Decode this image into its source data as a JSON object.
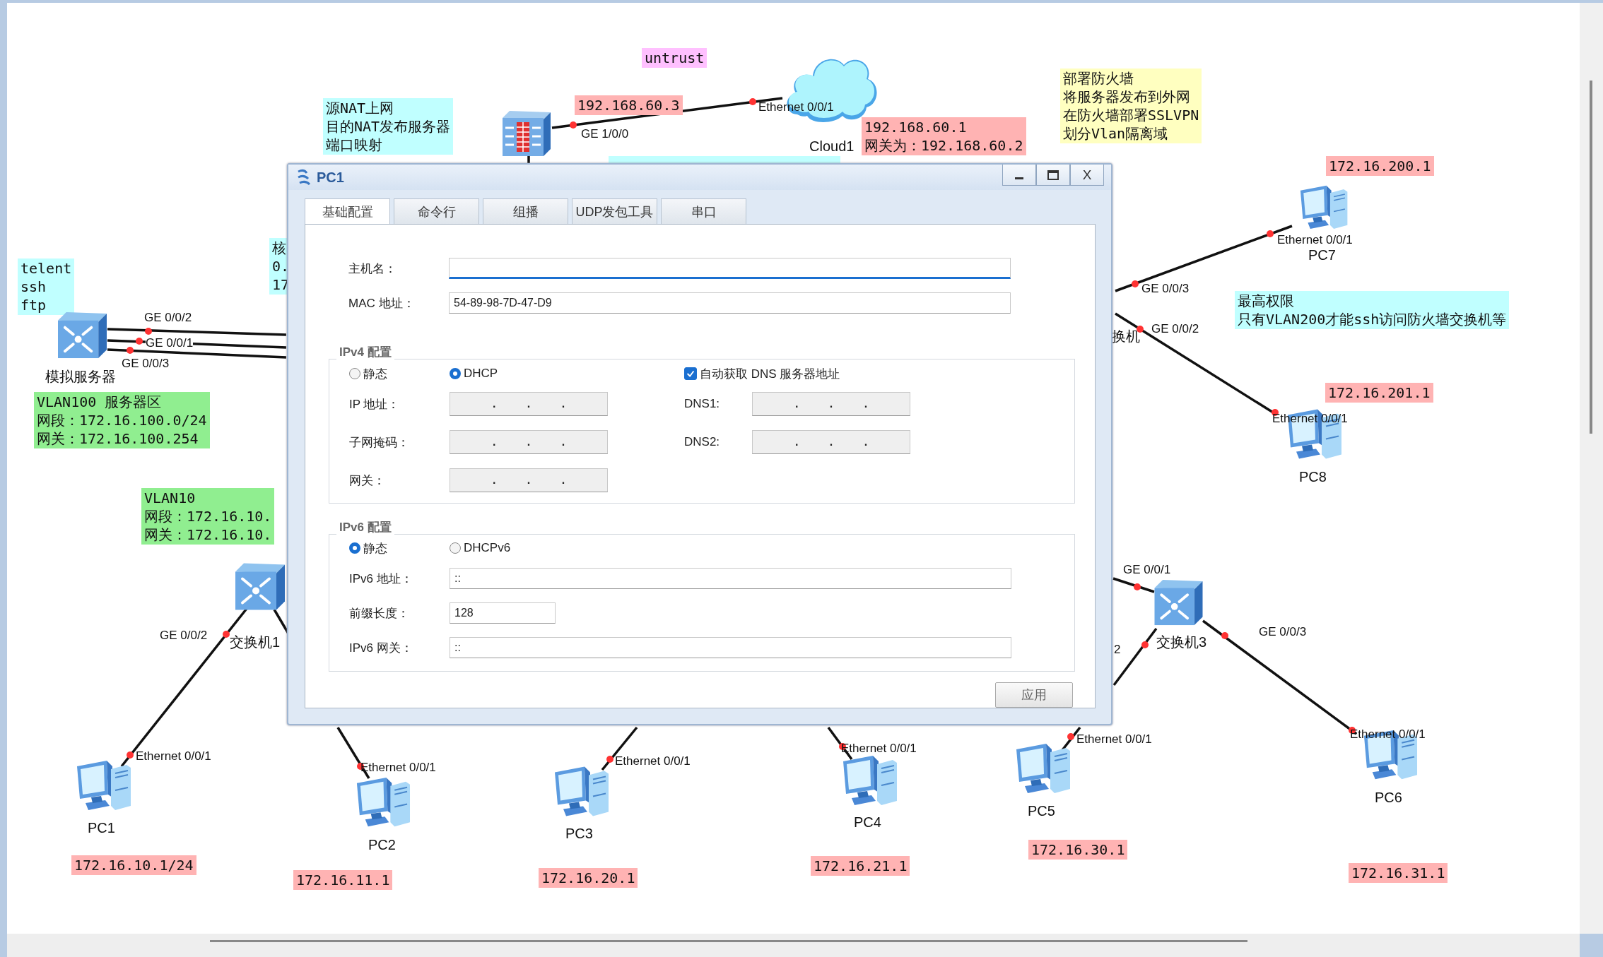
{
  "canvas": {
    "notes": [
      {
        "color": "#ffc0ff",
        "lines": [
          "untrust"
        ]
      },
      {
        "color": "#c0ffff",
        "lines": [
          "源NAT上网",
          "目的NAT发布服务器",
          "端口映射"
        ]
      },
      {
        "color": "#ffb3b3",
        "lines": [
          "192.168.60.3"
        ]
      },
      {
        "color": "#ffb3b3",
        "lines": [
          "192.168.60.1",
          "网关为：192.168.60.2"
        ]
      },
      {
        "color": "#ffffc0",
        "lines": [
          "部署防火墙",
          "将服务器发布到外网",
          "在防火墙部署SSLVPN",
          "划分Vlan隔离域"
        ]
      },
      {
        "color": "#ffb3b3",
        "lines": [
          "172.16.200.1"
        ]
      },
      {
        "color": "#c0ffff",
        "lines": [
          "最高权限",
          "只有VLAN200才能ssh访问防火墙交换机等"
        ]
      },
      {
        "color": "#ffb3b3",
        "lines": [
          "172.16.201.1"
        ]
      },
      {
        "color": "#c0ffff",
        "lines": [
          "telent",
          "ssh",
          "ftp"
        ]
      },
      {
        "color": "#c0ffff",
        "lines": [
          "核",
          "0.",
          "17"
        ]
      },
      {
        "color": "#90ee90",
        "lines": [
          "VLAN100 服务器区",
          "网段：172.16.100.0/24",
          "网关：172.16.100.254"
        ]
      },
      {
        "color": "#90ee90",
        "lines": [
          "VLAN10",
          "网段：172.16.10.",
          "网关：172.16.10."
        ]
      },
      {
        "color": "#ffb3b3",
        "lines": [
          "172.16.10.1/24"
        ]
      },
      {
        "color": "#ffb3b3",
        "lines": [
          "172.16.11.1"
        ]
      },
      {
        "color": "#ffb3b3",
        "lines": [
          "172.16.20.1"
        ]
      },
      {
        "color": "#ffb3b3",
        "lines": [
          "172.16.21.1"
        ]
      },
      {
        "color": "#ffb3b3",
        "lines": [
          "172.16.30.1"
        ]
      },
      {
        "color": "#ffb3b3",
        "lines": [
          "172.16.31.1"
        ]
      }
    ],
    "devices": [
      {
        "kind": "firewall"
      },
      {
        "kind": "cloud",
        "label": "Cloud1"
      },
      {
        "kind": "switch",
        "label": "模拟服务器"
      },
      {
        "kind": "switch",
        "label": "交换机1"
      },
      {
        "kind": "switch",
        "label": "交换机3"
      },
      {
        "kind": "label",
        "label": "换机"
      },
      {
        "kind": "pc",
        "label": "PC1"
      },
      {
        "kind": "pc",
        "label": "PC2"
      },
      {
        "kind": "pc",
        "label": "PC3"
      },
      {
        "kind": "pc",
        "label": "PC4"
      },
      {
        "kind": "pc",
        "label": "PC5"
      },
      {
        "kind": "pc",
        "label": "PC6"
      },
      {
        "kind": "pc",
        "label": "PC7"
      },
      {
        "kind": "pc",
        "label": "PC8"
      }
    ],
    "links": [
      {
        "ports": [
          "GE 1/0/0",
          "Ethernet 0/0/1"
        ]
      },
      {
        "ports": [
          "GE 0/0/2"
        ]
      },
      {
        "ports": [
          "GE 0/0/1"
        ]
      },
      {
        "ports": [
          "GE 0/0/3"
        ]
      },
      {
        "ports": [
          "GE 0/0/2",
          "Ethernet 0/0/1"
        ]
      },
      {
        "ports": [
          "Ethernet 0/0/1"
        ]
      },
      {
        "ports": [
          "Ethernet 0/0/1"
        ]
      },
      {
        "ports": [
          "Ethernet 0/0/1"
        ]
      },
      {
        "ports": [
          "GE 0/0/1"
        ]
      },
      {
        "ports": [
          "2"
        ]
      },
      {
        "ports": [
          "Ethernet 0/0/1"
        ]
      },
      {
        "ports": [
          "GE 0/0/3",
          "Ethernet 0/0/1"
        ]
      },
      {
        "ports": [
          "GE 0/0/3",
          "Ethernet 0/0/1"
        ]
      },
      {
        "ports": [
          "GE 0/0/2",
          "Ethernet 0/0/1"
        ]
      }
    ]
  },
  "dialog": {
    "title": "PC1",
    "close_label": "X",
    "tabs": [
      {
        "label": "基础配置",
        "selected": true
      },
      {
        "label": "命令行",
        "selected": false
      },
      {
        "label": "组播",
        "selected": false
      },
      {
        "label": "UDP发包工具",
        "selected": false
      },
      {
        "label": "串口",
        "selected": false
      }
    ],
    "fields": [
      {
        "label": "主机名：",
        "focused": true
      },
      {
        "label": "MAC 地址：",
        "value": "54-89-98-7D-47-D9",
        "focused": false
      }
    ],
    "ipv4": {
      "title": "IPv4 配置",
      "modes": [
        {
          "label": "静态",
          "selected": false
        },
        {
          "label": "DHCP",
          "selected": true
        }
      ],
      "auto_dns": {
        "label": "自动获取 DNS 服务器地址",
        "checked": true
      },
      "fields": [
        {
          "label": "IP 地址：",
          "value": ". . .",
          "disabled": true
        },
        {
          "label": "子网掩码：",
          "value": ". . .",
          "disabled": true
        },
        {
          "label": "网关：",
          "value": ". . .",
          "disabled": true
        }
      ],
      "dns": [
        {
          "label": "DNS1:",
          "value": ". . .",
          "disabled": true
        },
        {
          "label": "DNS2:",
          "value": ". . .",
          "disabled": true
        }
      ]
    },
    "ipv6": {
      "title": "IPv6 配置",
      "modes": [
        {
          "label": "静态",
          "selected": true
        },
        {
          "label": "DHCPv6",
          "selected": false
        }
      ],
      "fields": [
        {
          "label": "IPv6 地址：",
          "value": "::"
        },
        {
          "label": "前缀长度：",
          "value": "128"
        },
        {
          "label": "IPv6 网关：",
          "value": "::"
        }
      ]
    },
    "apply_button": "应用"
  }
}
